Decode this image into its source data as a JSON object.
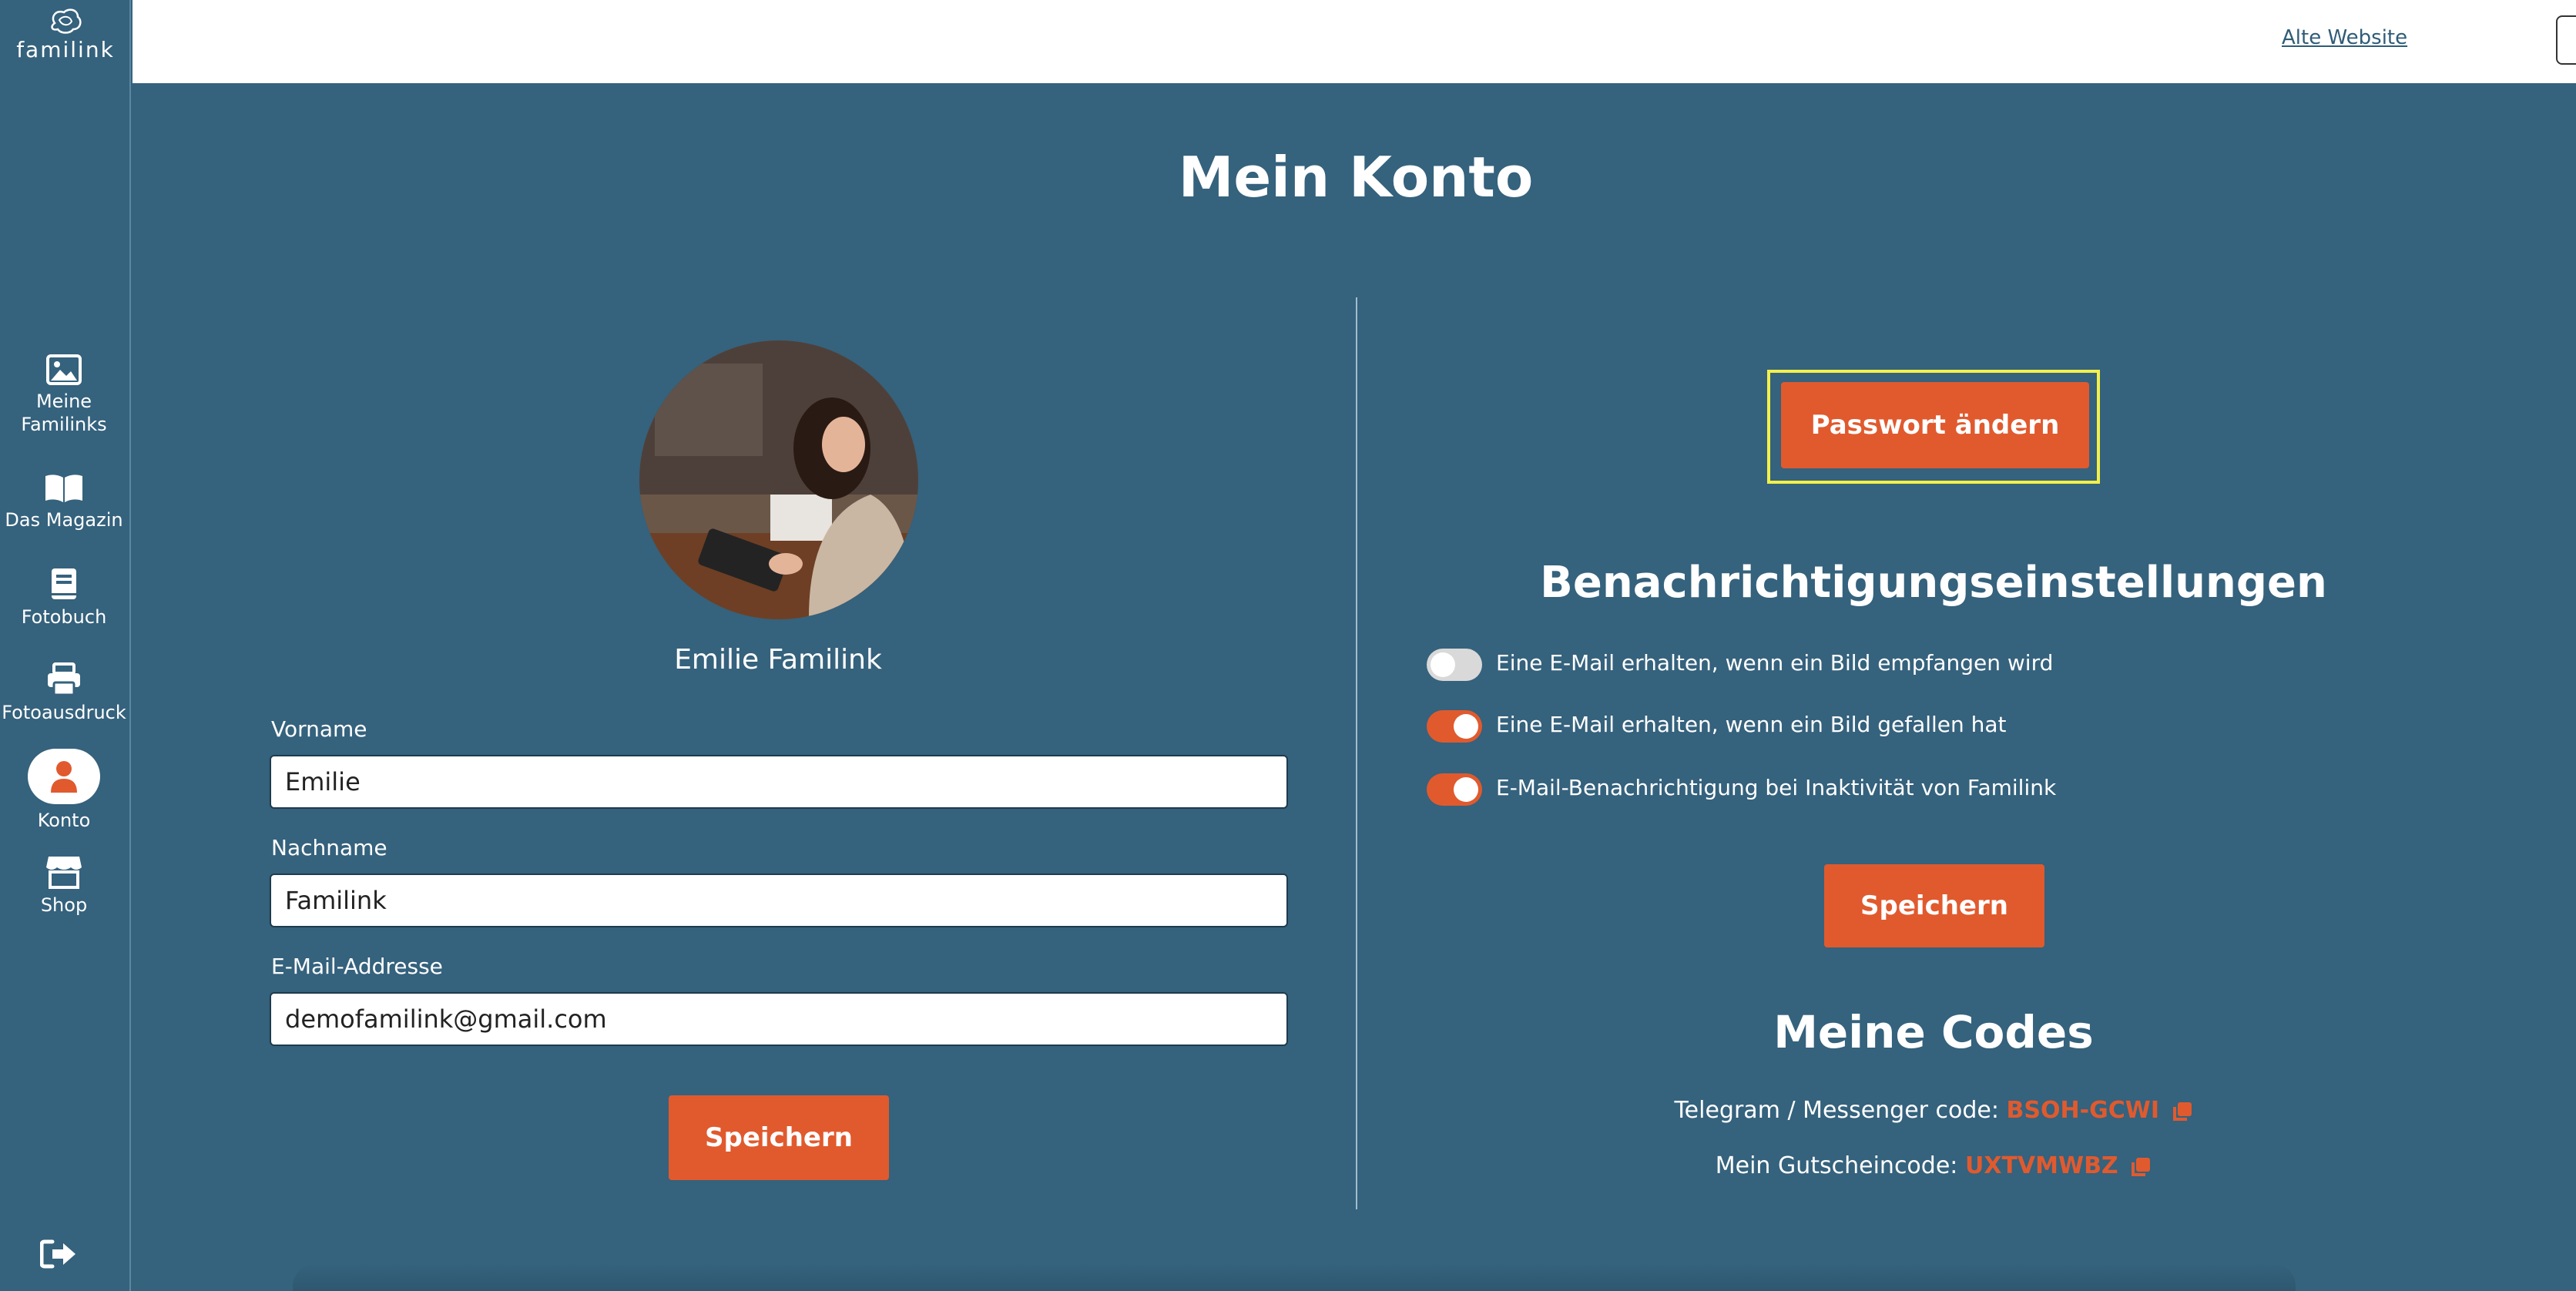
{
  "app": {
    "logo_text": "familink"
  },
  "sidebar": {
    "items": [
      {
        "label": "Meine Familinks",
        "icon": "image-icon"
      },
      {
        "label": "Das Magazin",
        "icon": "book-open-icon"
      },
      {
        "label": "Fotobuch",
        "icon": "photobook-icon"
      },
      {
        "label": "Fotoausdruck",
        "icon": "printer-icon"
      },
      {
        "label": "Konto",
        "icon": "user-icon",
        "active": true
      },
      {
        "label": "Shop",
        "icon": "shop-icon"
      }
    ],
    "logout_icon": "logout-icon"
  },
  "header": {
    "old_site_link": "Alte Website",
    "language": "de",
    "help": "?"
  },
  "page": {
    "title": "Mein Konto"
  },
  "profile": {
    "name": "Emilie Familink",
    "fields": {
      "first_name_label": "Vorname",
      "first_name_value": "Emilie",
      "last_name_label": "Nachname",
      "last_name_value": "Familink",
      "email_label": "E-Mail-Addresse",
      "email_value": "demofamilink@gmail.com"
    },
    "save_label": "Speichern"
  },
  "password": {
    "button_label": "Passwort ändern"
  },
  "notifications": {
    "title": "Benachrichtigungseinstellungen",
    "items": [
      {
        "label": "Eine E-Mail erhalten, wenn ein Bild empfangen wird",
        "enabled": false
      },
      {
        "label": "Eine E-Mail erhalten, wenn ein Bild gefallen hat",
        "enabled": true
      },
      {
        "label": "E-Mail-Benachrichtigung bei Inaktivität von Familink",
        "enabled": true
      }
    ],
    "save_label": "Speichern"
  },
  "codes": {
    "title": "Meine Codes",
    "telegram_label": "Telegram / Messenger code:",
    "telegram_value": "BSOH-GCWI",
    "voucher_label": "Mein Gutscheincode:",
    "voucher_value": "UXTVMWBZ"
  },
  "colors": {
    "background": "#35627d",
    "accent": "#e05a2e",
    "highlight": "#f3f04a",
    "toggle_off": "#d9d9d9"
  }
}
